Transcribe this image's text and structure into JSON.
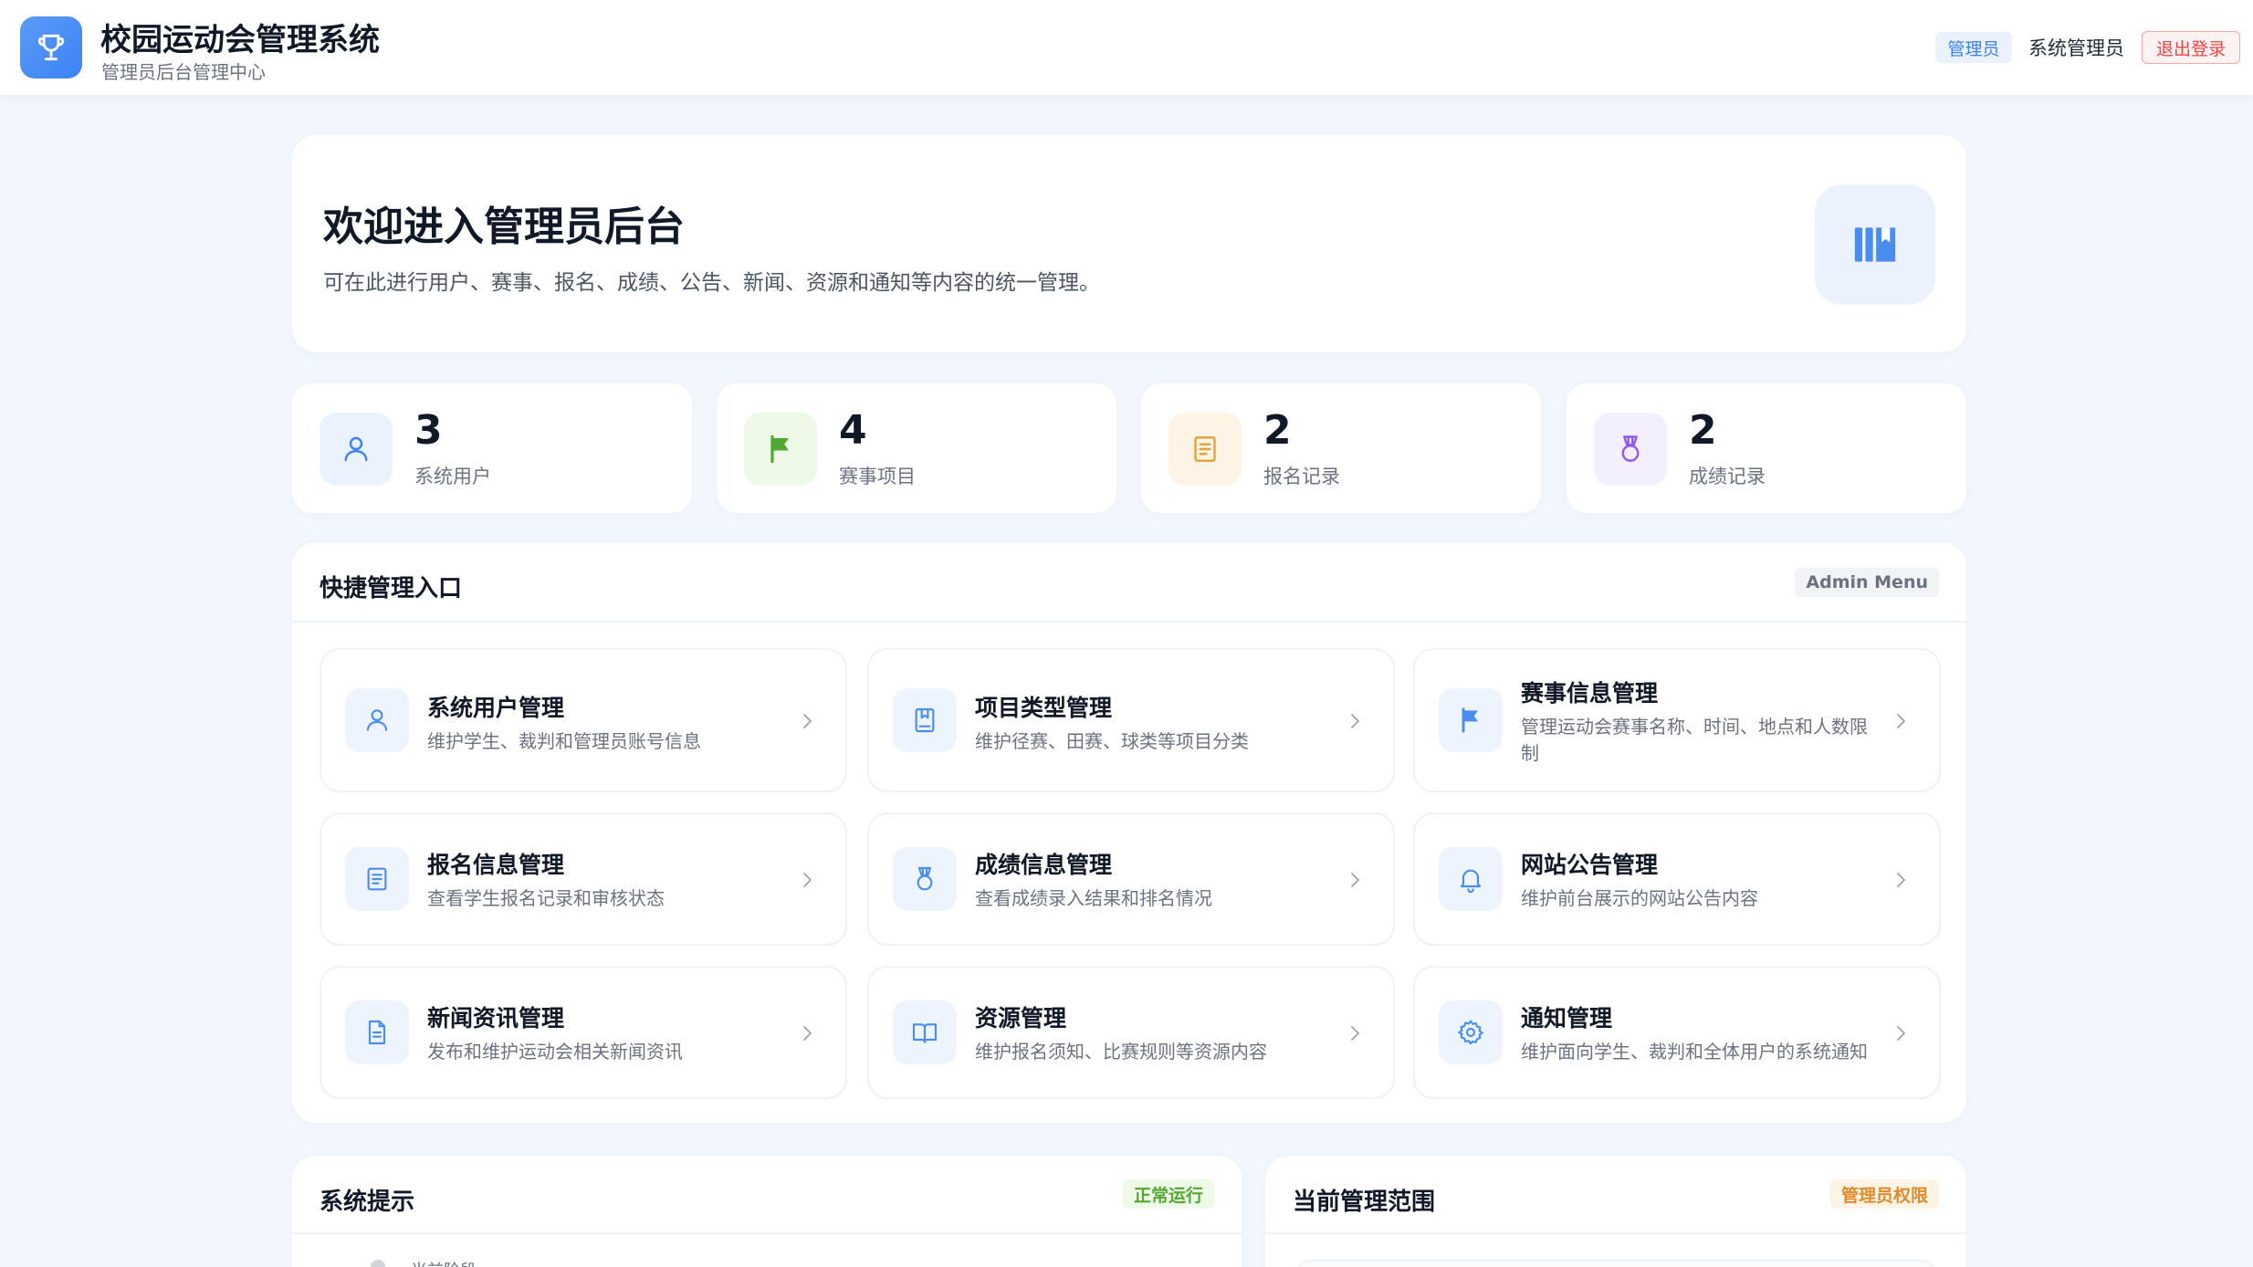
{
  "header": {
    "title": "校园运动会管理系统",
    "subtitle": "管理员后台管理中心",
    "role_badge": "管理员",
    "user_name": "系统管理员",
    "logout_label": "退出登录",
    "logo_icon": "trophy-icon"
  },
  "welcome": {
    "title": "欢迎进入管理员后台",
    "description": "可在此进行用户、赛事、报名、成绩、公告、新闻、资源和通知等内容的统一管理。",
    "icon": "book-icon"
  },
  "stats": [
    {
      "value": "3",
      "label": "系统用户",
      "icon": "user-icon",
      "color": "#3b82f6",
      "bg": "#eaf2fe"
    },
    {
      "value": "4",
      "label": "赛事项目",
      "icon": "flag-icon",
      "color": "#52a832",
      "bg": "#eef9e8"
    },
    {
      "value": "2",
      "label": "报名记录",
      "icon": "document-icon",
      "color": "#e6a23c",
      "bg": "#fdf4e6"
    },
    {
      "value": "2",
      "label": "成绩记录",
      "icon": "medal-icon",
      "color": "#8b5cf6",
      "bg": "#f3efff"
    }
  ],
  "quick": {
    "title": "快捷管理入口",
    "tag": "Admin Menu",
    "items": [
      {
        "title": "系统用户管理",
        "desc": "维护学生、裁判和管理员账号信息",
        "icon": "user-icon"
      },
      {
        "title": "项目类型管理",
        "desc": "维护径赛、田赛、球类等项目分类",
        "icon": "notebook-icon"
      },
      {
        "title": "赛事信息管理",
        "desc": "管理运动会赛事名称、时间、地点和人数限制",
        "icon": "flag-icon"
      },
      {
        "title": "报名信息管理",
        "desc": "查看学生报名记录和审核状态",
        "icon": "document-icon"
      },
      {
        "title": "成绩信息管理",
        "desc": "查看成绩录入结果和排名情况",
        "icon": "medal-icon"
      },
      {
        "title": "网站公告管理",
        "desc": "维护前台展示的网站公告内容",
        "icon": "bell-icon"
      },
      {
        "title": "新闻资讯管理",
        "desc": "发布和维护运动会相关新闻资讯",
        "icon": "file-text-icon"
      },
      {
        "title": "资源管理",
        "desc": "维护报名须知、比赛规则等资源内容",
        "icon": "open-book-icon"
      },
      {
        "title": "通知管理",
        "desc": "维护面向学生、裁判和全体用户的系统通知",
        "icon": "gear-icon"
      }
    ]
  },
  "system": {
    "title": "系统提示",
    "tag": "正常运行",
    "first_item": "当前阶段"
  },
  "scope": {
    "title": "当前管理范围",
    "tag": "管理员权限"
  },
  "colors": {
    "accent": "#3b82f6",
    "background": "#f2f7fd",
    "danger": "#ef4444"
  }
}
